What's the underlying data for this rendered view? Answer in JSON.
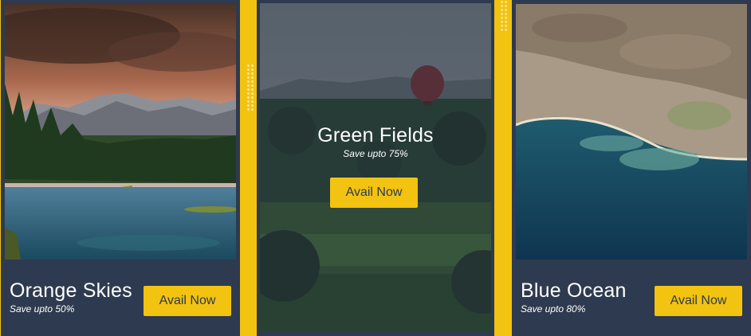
{
  "cards": [
    {
      "title": "Orange Skies",
      "subtitle": "Save upto 50%",
      "button": "Avail Now"
    },
    {
      "title": "Green Fields",
      "subtitle": "Save upto 75%",
      "button": "Avail Now"
    },
    {
      "title": "Blue Ocean",
      "subtitle": "Save upto 80%",
      "button": "Avail Now"
    }
  ],
  "colors": {
    "accent": "#f2c310",
    "card_bg": "#2e3a4f",
    "text": "#ffffff"
  }
}
